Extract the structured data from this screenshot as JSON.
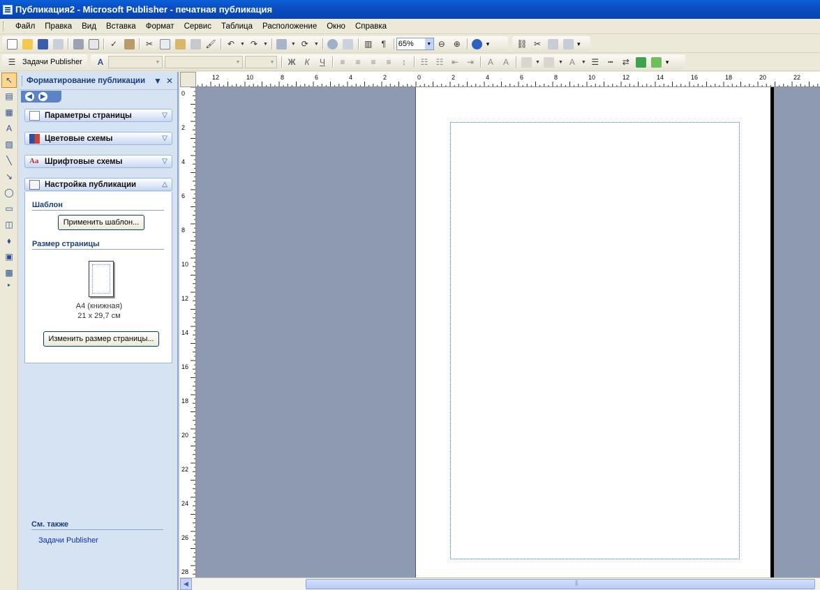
{
  "window": {
    "title": "Публикация2 - Microsoft Publisher - печатная публикация"
  },
  "menu": {
    "items": [
      "Файл",
      "Правка",
      "Вид",
      "Вставка",
      "Формат",
      "Сервис",
      "Таблица",
      "Расположение",
      "Окно",
      "Справка"
    ]
  },
  "toolbar": {
    "zoom_value": "65%",
    "tasks_label": "Задачи Publisher",
    "bold_label": "Ж",
    "italic_label": "К",
    "underline_label": "Ч",
    "pilcrow_label": "¶"
  },
  "taskpane": {
    "title": "Форматирование публикации",
    "sections": [
      {
        "label": "Параметры страницы",
        "icon": "page-setup-icon",
        "expanded": false
      },
      {
        "label": "Цветовые схемы",
        "icon": "color-scheme-icon",
        "expanded": false
      },
      {
        "label": "Шрифтовые схемы",
        "icon": "font-scheme-icon",
        "expanded": false
      },
      {
        "label": "Настройка публикации",
        "icon": "publication-setup-icon",
        "expanded": true
      }
    ],
    "template_heading": "Шаблон",
    "apply_template_button": "Применить шаблон...",
    "page_size_heading": "Размер страницы",
    "page_size_name": "A4 (книжная)",
    "page_size_dims": "21 x 29,7 см",
    "change_size_button": "Изменить размер страницы...",
    "see_also_heading": "См. также",
    "see_also_link": "Задачи Publisher"
  },
  "rulers": {
    "horizontal_labels": [
      "12",
      "10",
      "8",
      "6",
      "4",
      "2",
      "0",
      "2",
      "4",
      "6",
      "8",
      "10",
      "12",
      "14",
      "16",
      "18",
      "20",
      "22"
    ],
    "vertical_labels": [
      "0",
      "2",
      "4",
      "6",
      "8",
      "10",
      "12",
      "14",
      "16",
      "18",
      "20",
      "22",
      "24",
      "26",
      "28"
    ]
  },
  "colors": {
    "titlebar": "#0B4FC4",
    "workspace": "#8E9AB2",
    "taskpane": "#D6E3F3",
    "chrome": "#ECE9D8",
    "margin_guide": "#2B70C8"
  }
}
